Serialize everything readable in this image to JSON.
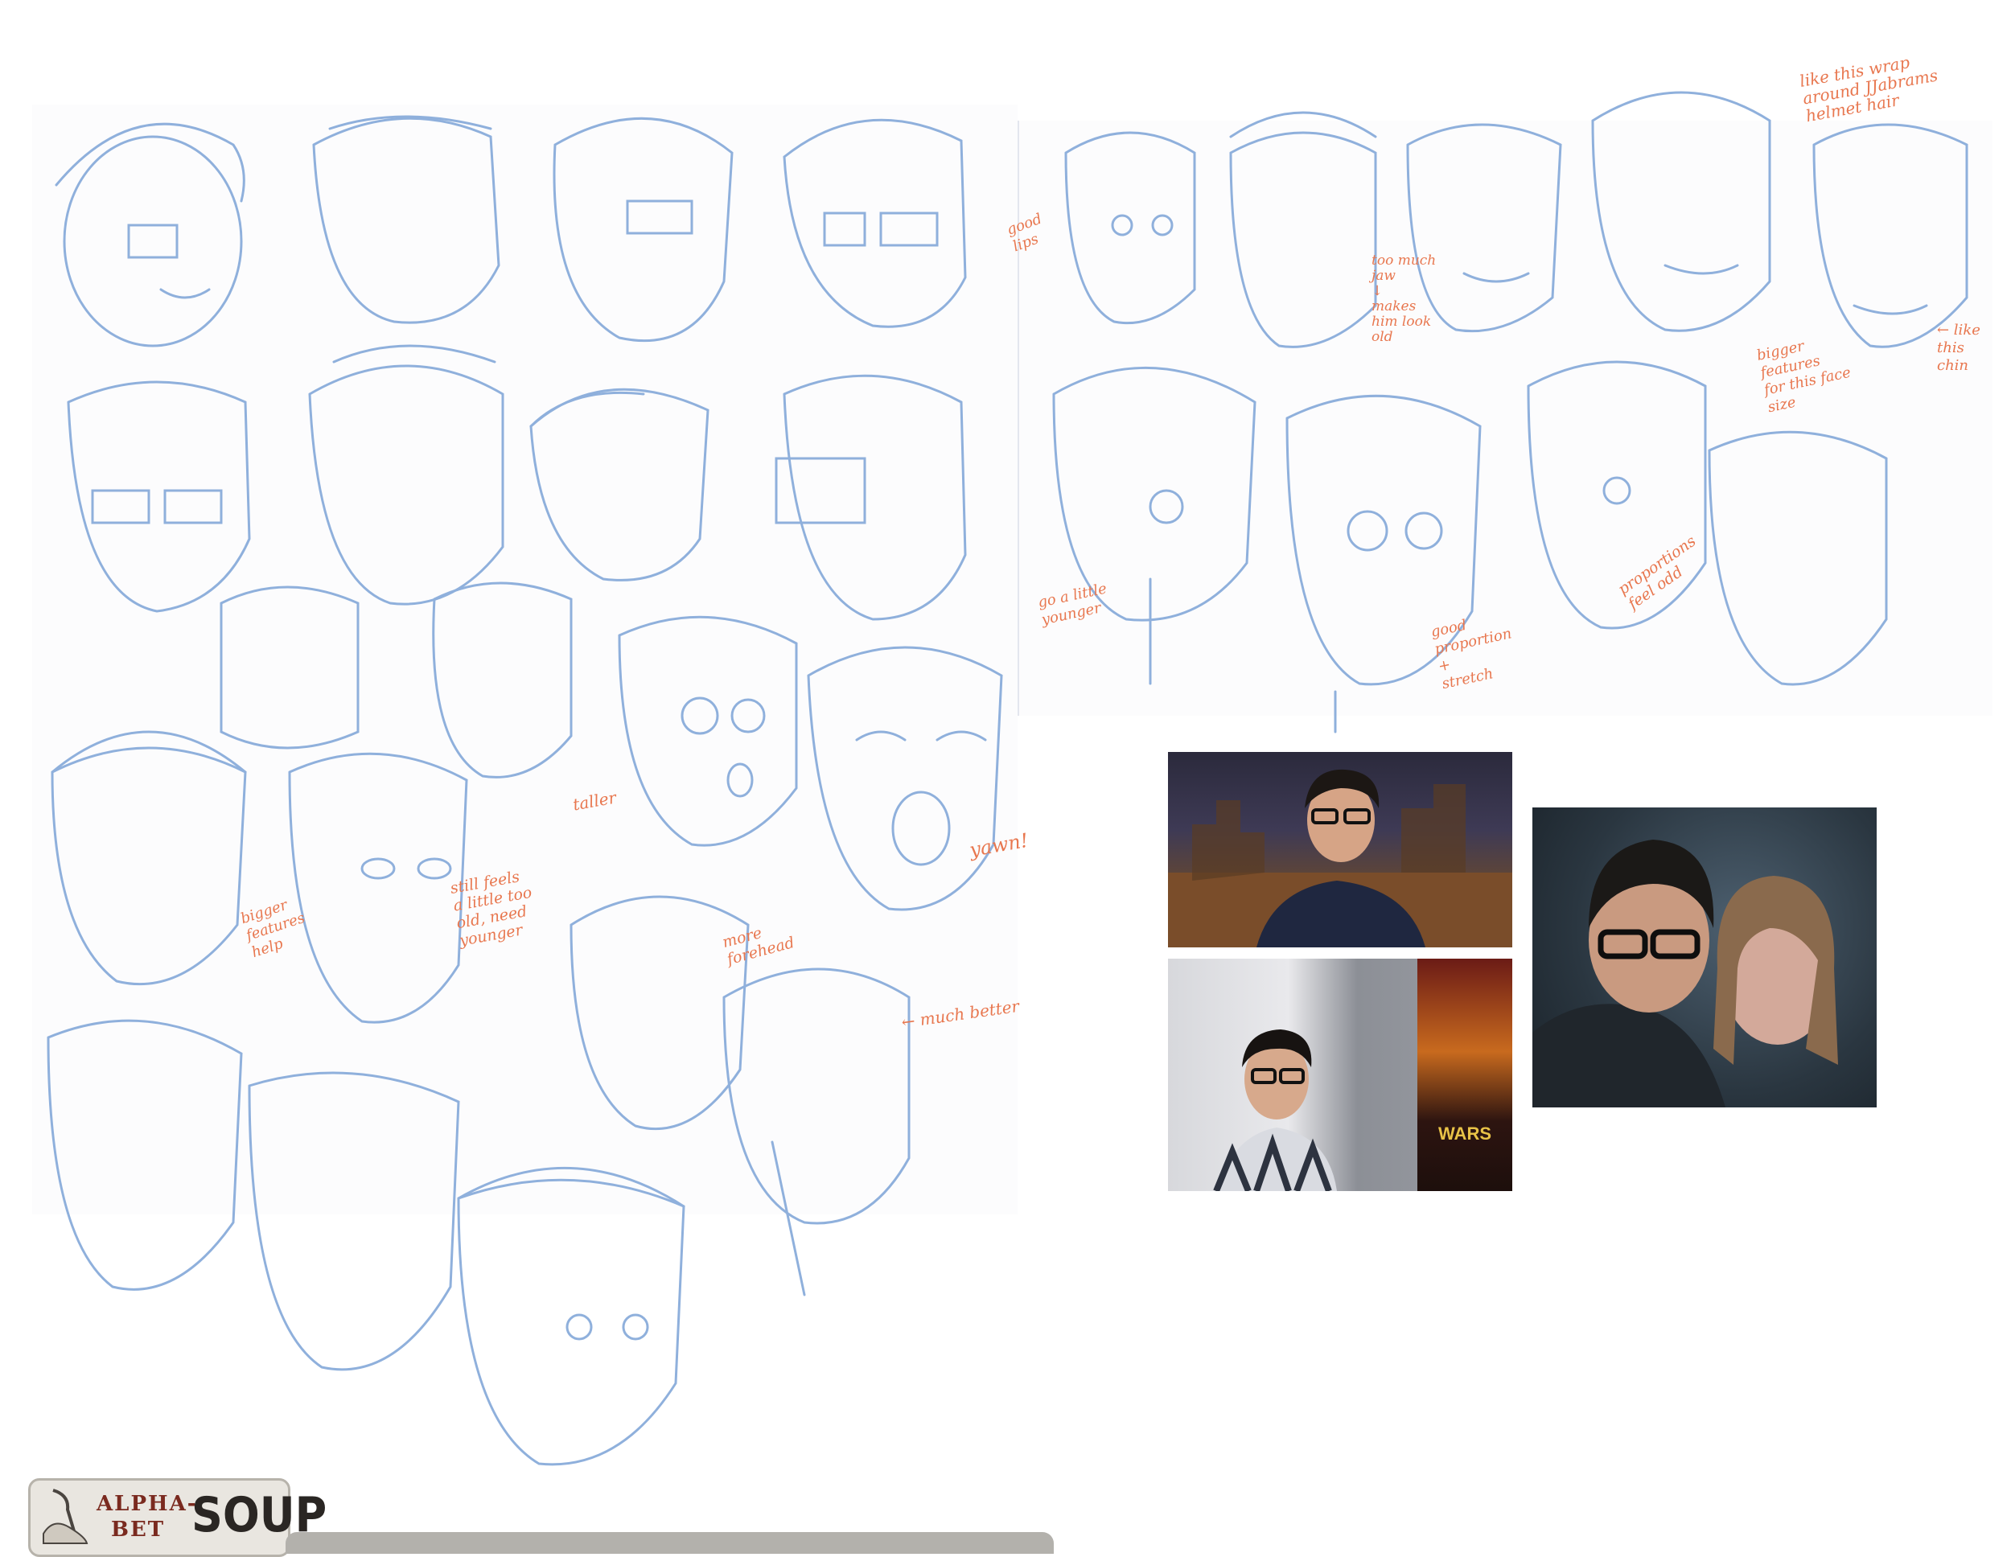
{
  "notes": {
    "like_wrap": "like this wrap\naround JJabrams\nhelmet hair",
    "good_lips": "good\nlips",
    "too_much_jaw": "too much\njaw\n↓\nmakes\nhim look\nold",
    "bigger_features_face_size": "bigger\nfeatures\nfor this face\nsize",
    "like_chin": "← like\nthis\nchin",
    "go_younger": "go a little\nyounger",
    "good_proportion": "good\nproportion\n+\nstretch",
    "proportions_feel_odd": "proportions\nfeel odd",
    "taller": "taller",
    "yawn": "yawn!",
    "bigger_features_help": "bigger\nfeatures\nhelp",
    "still_feels_old": "still feels\na little too\nold, need\nyounger",
    "more_forehead": "more\nforehead",
    "much_better": "← much better"
  },
  "photos": {
    "poster_title": "WARS"
  },
  "logo": {
    "alpha": "ALPHA-",
    "bet": "BET",
    "soup": "SOUP"
  },
  "colors": {
    "sketch_blue": "#8fb0dc",
    "note_orange": "#e8774f",
    "logo_red": "#7a2a1f"
  }
}
